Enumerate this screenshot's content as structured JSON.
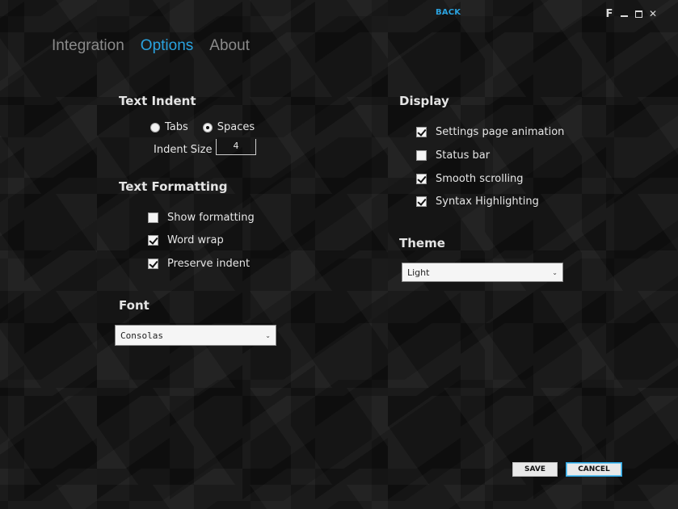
{
  "titlebar": {
    "back_label": "BACK",
    "app_letter": "F",
    "minimize_icon": "minimize-icon",
    "maximize_icon": "maximize-icon",
    "close_glyph": "✕"
  },
  "tabs": [
    {
      "label": "Integration",
      "active": false
    },
    {
      "label": "Options",
      "active": true
    },
    {
      "label": "About",
      "active": false
    }
  ],
  "text_indent": {
    "heading": "Text Indent",
    "radio_tabs": "Tabs",
    "radio_spaces": "Spaces",
    "selected": "Spaces",
    "indent_size_label": "Indent Size",
    "indent_size_value": "4"
  },
  "text_formatting": {
    "heading": "Text Formatting",
    "items": [
      {
        "label": "Show formatting",
        "checked": false
      },
      {
        "label": "Word wrap",
        "checked": true
      },
      {
        "label": "Preserve indent",
        "checked": true
      }
    ]
  },
  "font": {
    "heading": "Font",
    "selected": "Consolas"
  },
  "display": {
    "heading": "Display",
    "items": [
      {
        "label": "Settings page animation",
        "checked": true
      },
      {
        "label": "Status bar",
        "checked": false
      },
      {
        "label": "Smooth scrolling",
        "checked": true
      },
      {
        "label": "Syntax Highlighting",
        "checked": true
      }
    ]
  },
  "theme": {
    "heading": "Theme",
    "selected": "Light"
  },
  "actions": {
    "save_label": "SAVE",
    "cancel_label": "CANCEL"
  },
  "colors": {
    "accent": "#2aa3e0",
    "background": "#151515"
  }
}
